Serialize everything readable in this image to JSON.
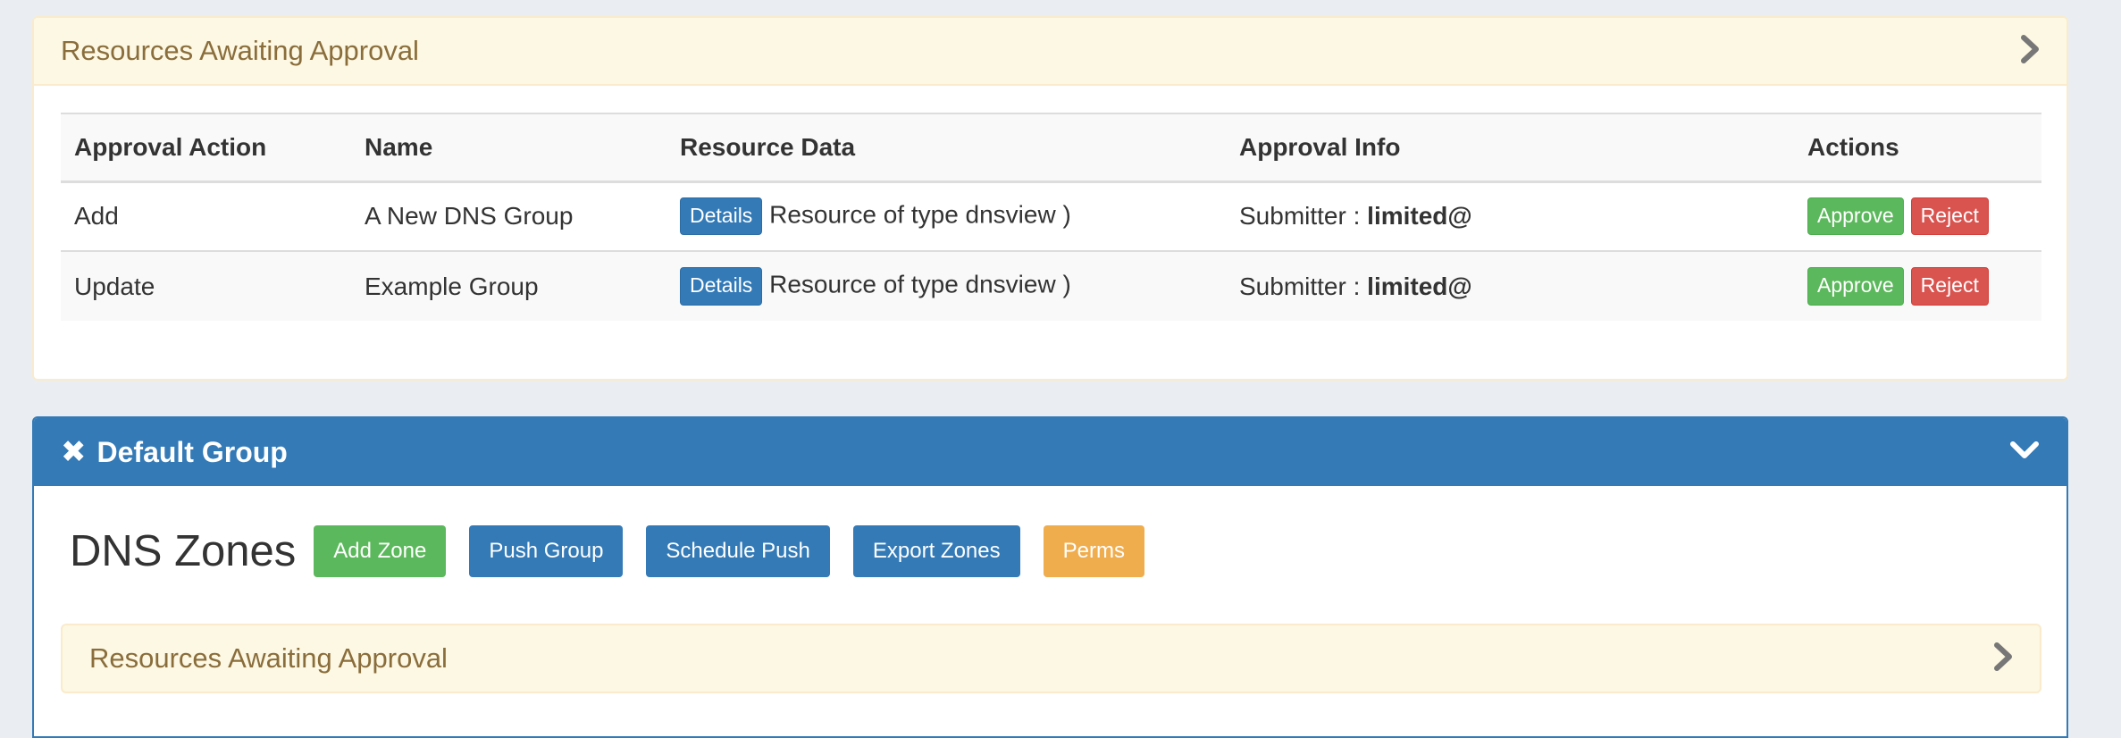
{
  "approval_panel": {
    "title": "Resources Awaiting Approval",
    "columns": [
      "Approval Action",
      "Name",
      "Resource Data",
      "Approval Info",
      "Actions"
    ],
    "rows": [
      {
        "action": "Add",
        "name": "A New DNS Group",
        "details_label": "Details",
        "resource_data": "Resource of type dnsview )",
        "submitter_label": "Submitter :",
        "submitter_value": "limited@",
        "approve_label": "Approve",
        "reject_label": "Reject"
      },
      {
        "action": "Update",
        "name": "Example Group",
        "details_label": "Details",
        "resource_data": "Resource of type dnsview )",
        "submitter_label": "Submitter :",
        "submitter_value": "limited@",
        "approve_label": "Approve",
        "reject_label": "Reject"
      }
    ]
  },
  "group_panel": {
    "close_glyph": "✖",
    "title": "Default Group",
    "dns_title": "DNS Zones",
    "buttons": {
      "add_zone": "Add Zone",
      "push_group": "Push Group",
      "schedule_push": "Schedule Push",
      "export_zones": "Export Zones",
      "perms": "Perms"
    },
    "inner_panel_title": "Resources Awaiting Approval"
  },
  "colors": {
    "primary": "#337ab7",
    "success": "#5cb85c",
    "danger": "#d9534f",
    "warning": "#f0ad4e",
    "warning_bg": "#fcf8e3",
    "warning_text": "#8a6d3b"
  },
  "icons": {
    "approval_toggle": "chevron-right-icon",
    "group_toggle": "chevron-down-icon",
    "group_close": "close-icon",
    "inner_toggle": "chevron-right-icon"
  }
}
